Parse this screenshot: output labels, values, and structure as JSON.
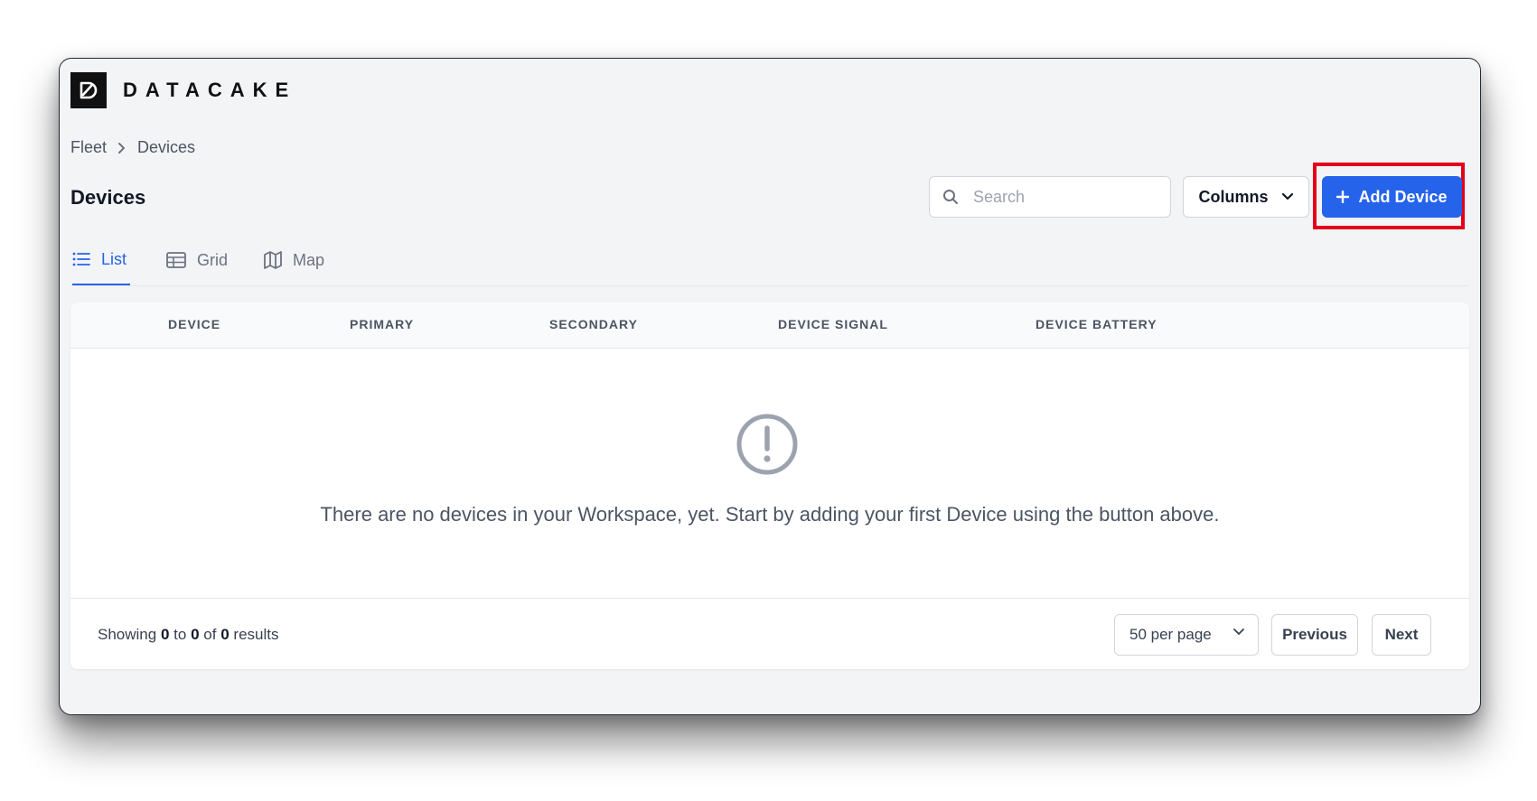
{
  "brand": {
    "name": "DATACAKE",
    "logo_icon": "datacake-logo-icon"
  },
  "breadcrumb": {
    "items": [
      "Fleet",
      "Devices"
    ],
    "separator_icon": "chevron-right-icon"
  },
  "header": {
    "title": "Devices",
    "search_placeholder": "Search",
    "search_value": "",
    "columns_label": "Columns",
    "add_device_label": "Add Device"
  },
  "tabs": [
    {
      "label": "List",
      "icon": "list-icon",
      "active": true
    },
    {
      "label": "Grid",
      "icon": "table-icon",
      "active": false
    },
    {
      "label": "Map",
      "icon": "map-icon",
      "active": false
    }
  ],
  "table": {
    "columns": [
      "DEVICE",
      "PRIMARY",
      "SECONDARY",
      "DEVICE SIGNAL",
      "DEVICE BATTERY"
    ],
    "empty_message": "There are no devices in your Workspace, yet. Start by adding your first Device using the button above.",
    "empty_icon": "exclamation-circle-icon"
  },
  "footer": {
    "showing_prefix": "Showing",
    "from": "0",
    "to_word": "to",
    "to": "0",
    "of_word": "of",
    "total": "0",
    "results_word": "results",
    "per_page": "50 per page",
    "previous_label": "Previous",
    "next_label": "Next"
  },
  "colors": {
    "accent": "#2563eb",
    "highlight": "#e3001b",
    "background": "#f3f4f6"
  }
}
